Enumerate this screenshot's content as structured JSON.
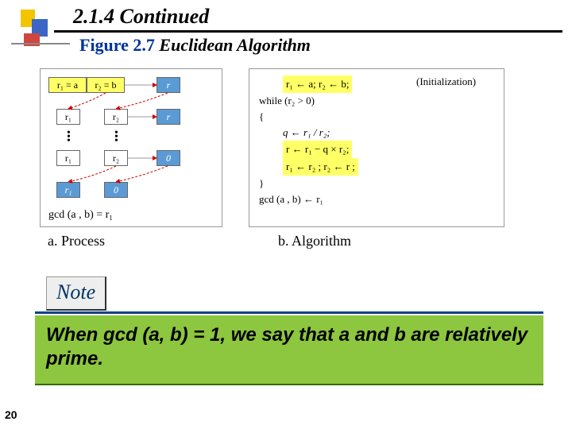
{
  "section_number": "2.1.4   Continued",
  "figure": {
    "label": "Figure 2.7",
    "name": "Euclidean Algorithm"
  },
  "panel_a": {
    "caption": "a. Process",
    "row1": {
      "c1": "r₁ = a",
      "c2": "r₂ = b",
      "c3": "r"
    },
    "row2": {
      "c1": "r₁",
      "c2": "r₂",
      "c3": "r"
    },
    "row3": {
      "c1": "r₁",
      "c2": "r₂",
      "c3": "0"
    },
    "row4": {
      "c1": "r₁",
      "c2": "0"
    },
    "gcd": "gcd (a , b) = r₁"
  },
  "panel_b": {
    "caption": "b. Algorithm",
    "init_label": "(Initialization)",
    "line1": "r₁ ← a;    r₂ ← b;",
    "line2": "while (r₂ > 0)",
    "line3": "{",
    "line4": "q ← r₁ / r₂;",
    "line5a": "r  ← r₁ − q × r₂;",
    "line5b": "r₁ ← r₂ ;  r₂ ← r ;",
    "line6": "}",
    "line7": "gcd (a , b) ← r₁"
  },
  "note_label": "Note",
  "statement": "When gcd (a, b) = 1, we say that a and b are relatively prime.",
  "page": "20"
}
